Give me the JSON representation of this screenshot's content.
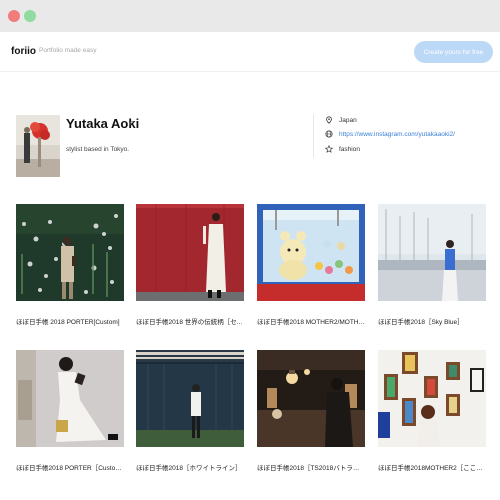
{
  "header": {
    "brand": "foriio",
    "tagline": "Portfolio made easy",
    "cta_label": "Create yours for free"
  },
  "profile": {
    "name": "Yutaka Aoki",
    "bio": "stylist based in Tokyo.",
    "location": "Japan",
    "website": "https://www.instagram.com/yutakaaoki2/",
    "tag": "fashion"
  },
  "works": [
    {
      "title": "ほぼ日手帳 2018 PORTER[Custom]"
    },
    {
      "title": "ほぼ日手帳2018 世界の伝統柄［セ..."
    },
    {
      "title": "ほぼ日手帳2018 MOTHER2/MOTHE..."
    },
    {
      "title": "ほぼ日手帳2018［Sky Blue］"
    },
    {
      "title": "ほぼ日手帳2018 PORTER［Custom］"
    },
    {
      "title": "ほぼ日手帳2018［ホワイトライン］"
    },
    {
      "title": "ほぼ日手帳2018［TS2018バトラー］"
    },
    {
      "title": "ほぼ日手帳2018MOTHER2［ここは..."
    }
  ],
  "colors": {
    "accent": "#bcd8f7",
    "link": "#3a7fd6"
  }
}
